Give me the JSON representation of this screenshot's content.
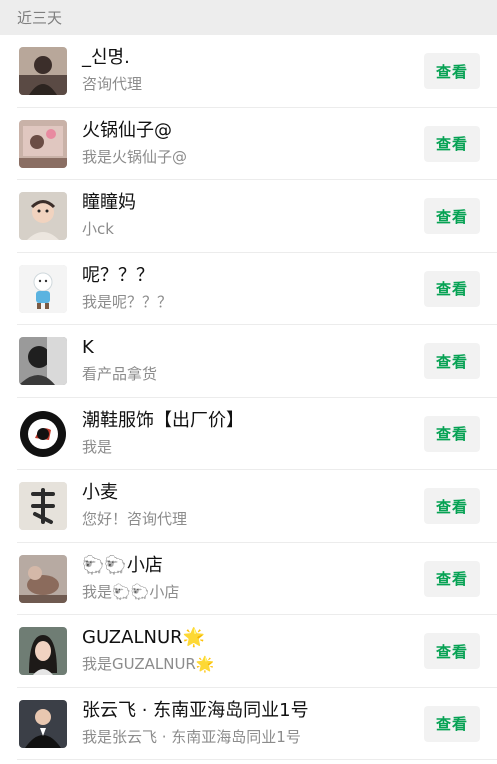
{
  "section_title": "近三天",
  "view_label": "查看",
  "accent_color": "#07a254",
  "contacts": [
    {
      "name": "_신명.",
      "sub": "咨询代理",
      "avatar": "woman-dark-avatar"
    },
    {
      "name": "火锅仙子@",
      "sub": "我是火锅仙子@",
      "avatar": "photo-pink-avatar"
    },
    {
      "name": "瞳瞳妈",
      "sub": "小ck",
      "avatar": "baby-avatar"
    },
    {
      "name": "呢？？？",
      "sub": "我是呢？？？",
      "avatar": "cartoon-figure-avatar"
    },
    {
      "name": "K",
      "sub": "看产品拿货",
      "avatar": "person-bw-avatar"
    },
    {
      "name": "潮鞋服饰【出厂价】",
      "sub": "我是",
      "avatar": "shoe-logo-avatar"
    },
    {
      "name": "小麦",
      "sub": "您好！咨询代理",
      "avatar": "calligraphy-avatar"
    },
    {
      "name": "🐑🐑小店",
      "sub": "我是🐑🐑小店",
      "avatar": "pet-photo-avatar"
    },
    {
      "name": "GUZALNUR🌟",
      "sub": "我是GUZALNUR🌟",
      "avatar": "woman-portrait-avatar"
    },
    {
      "name": "张云飞 · 东南亚海岛同业1号",
      "sub": "我是张云飞 · 东南亚海岛同业1号",
      "avatar": "man-suit-avatar"
    }
  ]
}
